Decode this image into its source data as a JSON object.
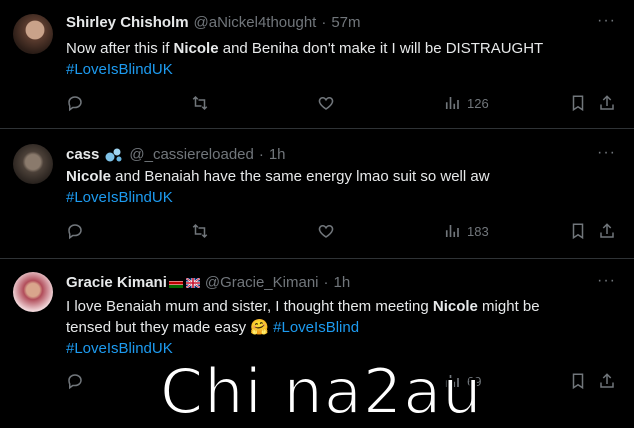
{
  "tweets": [
    {
      "name": "Shirley Chisholm",
      "handle": "@aNickel4thought",
      "sep": "·",
      "time": "57m",
      "text_parts": [
        "Now after this if ",
        "Nicole",
        " and Beniha don't make it I will be DISTRAUGHT"
      ],
      "hashtag": "#LoveIsBlindUK",
      "views": "126"
    },
    {
      "name": "cass",
      "handle": "@_cassiereloaded",
      "sep": "·",
      "time": "1h",
      "text_parts": [
        "Nicole",
        " and Benaiah have the same energy lmao suit so well aw"
      ],
      "hashtag": "#LoveIsBlindUK",
      "views": "183"
    },
    {
      "name": "Gracie Kimani",
      "handle": "@Gracie_Kimani",
      "sep": "·",
      "time": "1h",
      "text_line1": "I love Benaiah mum and sister, I thought them meeting ",
      "text_bold": "Nicole",
      "text_line1_end": " might be",
      "text_line2": "tensed but they made easy ",
      "emoji": "🤗",
      "inline_hashtag": "#LoveIsBlind",
      "hashtag": "#LoveIsBlindUK",
      "views": "69"
    }
  ],
  "icons": [
    "reply-icon",
    "retweet-icon",
    "like-icon",
    "views-icon",
    "bookmark-icon",
    "share-icon",
    "more-icon"
  ],
  "more_label": "···",
  "watermark": "Chi na2au",
  "colors": {
    "background": "#000000",
    "text": "#e7e9ea",
    "muted": "#71767b",
    "link": "#1d9bf0",
    "divider": "#2f3336"
  }
}
